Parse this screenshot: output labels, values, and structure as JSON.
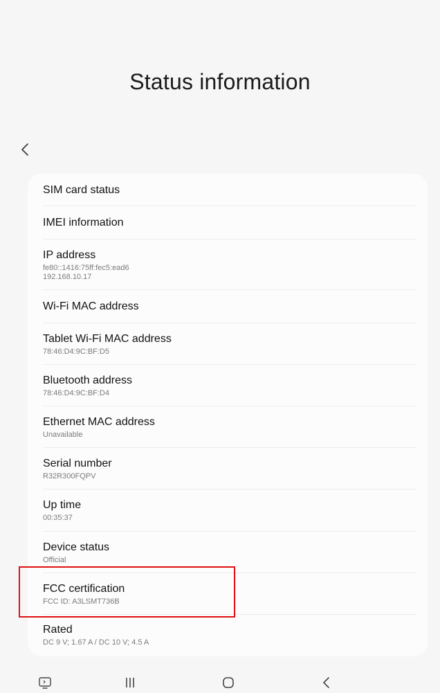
{
  "header": {
    "title": "Status information"
  },
  "items": [
    {
      "label": "SIM card status",
      "sub": []
    },
    {
      "label": "IMEI information",
      "sub": []
    },
    {
      "label": "IP address",
      "sub": [
        "fe80::1416:75ff:fec5:ead6",
        "192.168.10.17"
      ]
    },
    {
      "label": "Wi-Fi MAC address",
      "sub": []
    },
    {
      "label": "Tablet Wi-Fi MAC address",
      "sub": [
        "78:46:D4:9C:BF:D5"
      ]
    },
    {
      "label": "Bluetooth address",
      "sub": [
        "78:46:D4:9C:BF:D4"
      ]
    },
    {
      "label": "Ethernet MAC address",
      "sub": [
        "Unavailable"
      ]
    },
    {
      "label": "Serial number",
      "sub": [
        "R32R300FQPV"
      ]
    },
    {
      "label": "Up time",
      "sub": [
        "00:35:37"
      ]
    },
    {
      "label": "Device status",
      "sub": [
        "Official"
      ]
    },
    {
      "label": "FCC certification",
      "sub": [
        "FCC ID: A3LSMT736B"
      ]
    },
    {
      "label": "Rated",
      "sub": [
        "DC 9 V; 1.67 A / DC 10 V; 4.5 A"
      ]
    }
  ],
  "icons": {
    "back": "chevron-left-icon",
    "nav_screenshot": "screenshot-icon",
    "nav_recents": "recents-icon",
    "nav_home": "home-icon",
    "nav_back": "back-icon"
  },
  "colors": {
    "background": "#f6f6f6",
    "card": "#fcfcfc",
    "highlight": "#e01010"
  }
}
